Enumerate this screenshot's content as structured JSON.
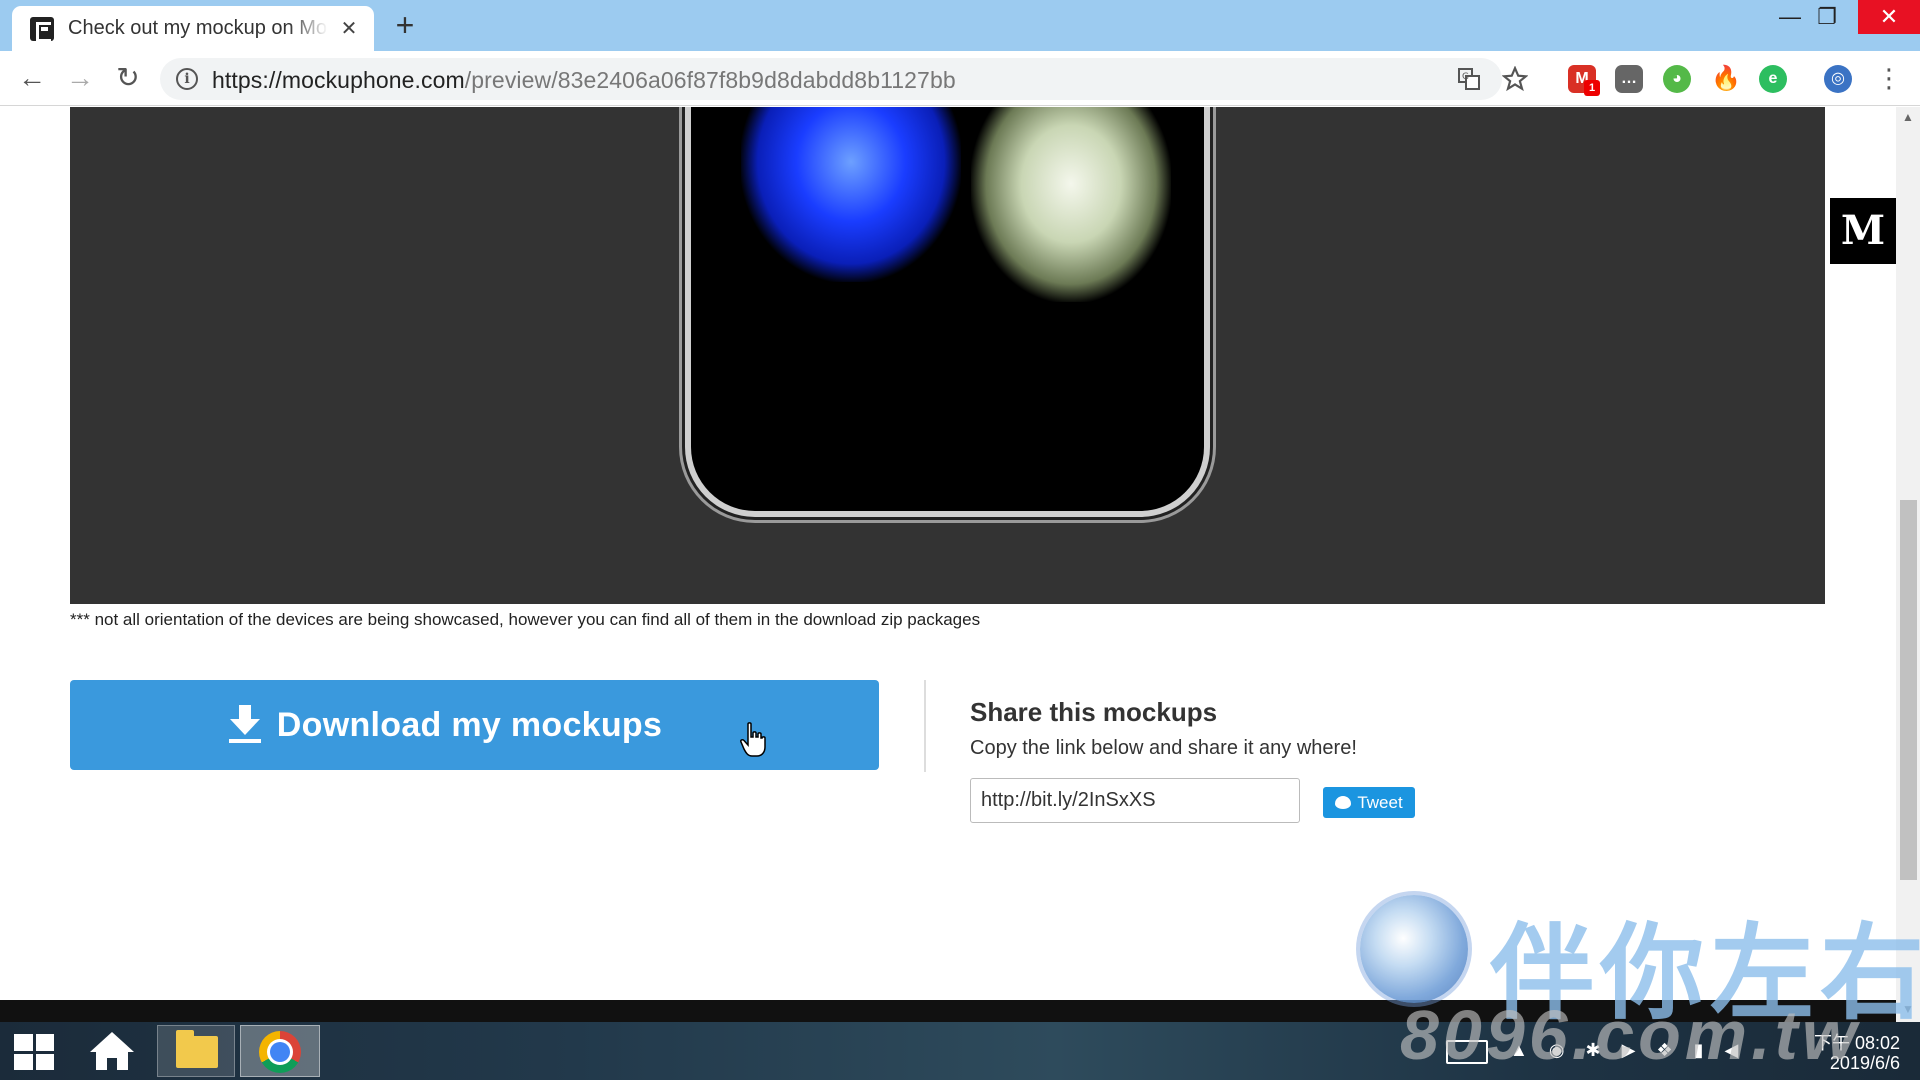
{
  "browser": {
    "tab_title": "Check out my mockup on Mockuphone",
    "tab_close": "✕",
    "new_tab": "+",
    "window_controls": {
      "minimize": "—",
      "maximize": "❐",
      "close": "✕"
    },
    "nav": {
      "back": "←",
      "forward": "→",
      "reload": "↻"
    },
    "url_host": "https://mockuphone.com",
    "url_path": "/preview/83e2406a06f87f8b9d8dabdd8b1127bb",
    "extensions": {
      "gmail_badge": "1"
    },
    "menu": "⋮"
  },
  "page": {
    "preview_note": "*** not all orientation of the devices are being showcased, however you can find all of them in the download zip packages",
    "download_label": "Download my mockups",
    "share_title": "Share this mockups",
    "share_subtitle": "Copy the link below and share it any where!",
    "share_link": "http://bit.ly/2InSxXS",
    "tweet_label": "Tweet",
    "medium_badge": "M"
  },
  "taskbar": {
    "clock_time": "下午 08:02",
    "clock_date": "2019/6/6"
  },
  "watermark": {
    "chinese": "伴你左右",
    "domain": "8096.com.tw"
  },
  "colors": {
    "tabstrip": "#9ccbf0",
    "download_button": "#3a99dd",
    "tweet_button": "#1b95e0",
    "preview_bg": "#333333"
  }
}
